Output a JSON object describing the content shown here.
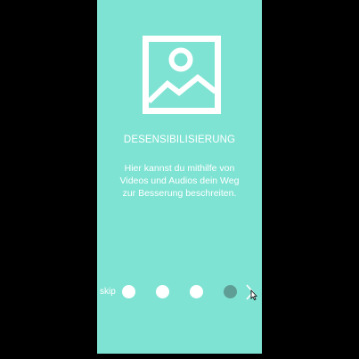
{
  "colors": {
    "background": "#000000",
    "screen": "#7fe3d3",
    "text": "#ffffff",
    "dot_inactive": "#ffffff",
    "dot_active": "#5f9e94"
  },
  "onboarding": {
    "hero_icon": "image-placeholder-icon",
    "title": "DESENSIBILISIERUNG",
    "description_lines": [
      "Hier kannst du mithilfe von",
      "Videos und Audios dein Weg",
      "zur Besserung beschreiten."
    ]
  },
  "footer": {
    "skip_label": "skip",
    "page_count": 4,
    "active_page": 4,
    "next_icon": "chevron-right-icon"
  }
}
